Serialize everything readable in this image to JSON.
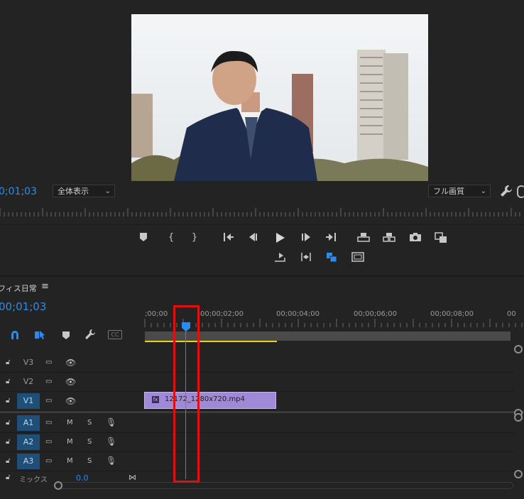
{
  "monitor": {
    "timecode": "0;01;03",
    "zoom_label": "全体表示",
    "quality_label": "フル画質",
    "wrench_icon": "wrench-icon"
  },
  "transport": {
    "row1": [
      "add-marker-icon",
      "mark-in-icon",
      "mark-out-icon",
      "go-to-in-icon",
      "step-back-icon",
      "play-icon",
      "step-forward-icon",
      "go-to-out-icon",
      "lift-icon",
      "extract-icon",
      "export-frame-icon",
      "comparison-view-icon"
    ],
    "row2": [
      "insert-icon",
      "trim-icon",
      "overwrite-icon",
      "safe-margins-icon"
    ]
  },
  "timeline": {
    "sequence_name": "フィス日常",
    "timecode": "00;01;03",
    "ruler_labels": [
      ";00;00",
      "00;00;02;00",
      "00;00;04;00",
      "00;00;06;00",
      "00;00;08;00",
      "00"
    ],
    "tracks_video": [
      {
        "label": "V3",
        "active": false
      },
      {
        "label": "V2",
        "active": false
      },
      {
        "label": "V1",
        "active": true
      }
    ],
    "tracks_audio": [
      {
        "label": "A1",
        "active": true
      },
      {
        "label": "A2",
        "active": true
      },
      {
        "label": "A3",
        "active": true
      }
    ],
    "audio_toggle_m": "M",
    "audio_toggle_s": "S",
    "mix_label": "ミックス",
    "mix_value": "0.0",
    "clip_name": "12172_1280x720.mp4",
    "clip_color": "#a08ad8"
  },
  "colors": {
    "accent_blue": "#2d8ceb",
    "work_area_yellow": "#e8d21a",
    "highlight_red": "#e01010"
  }
}
